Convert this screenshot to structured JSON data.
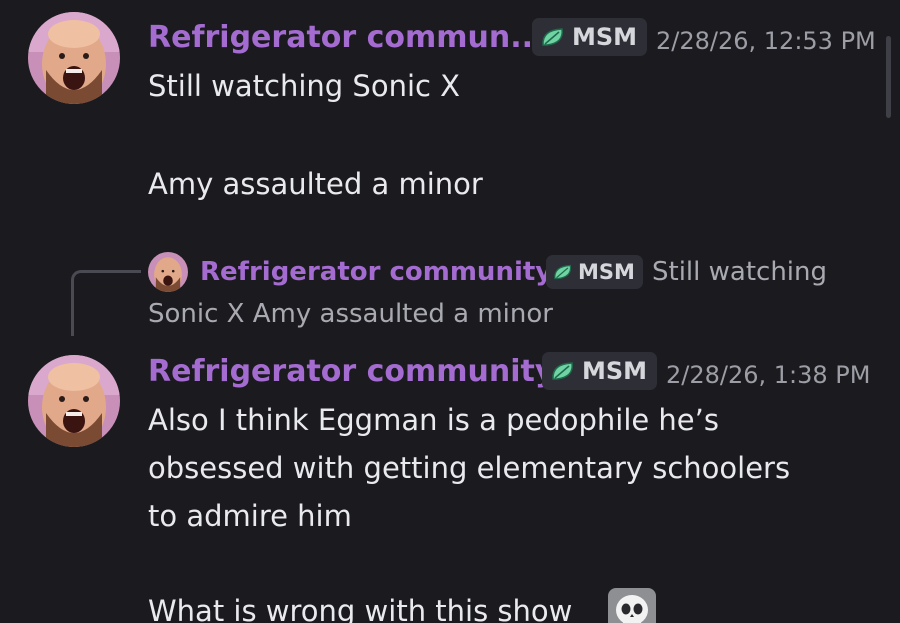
{
  "messages": [
    {
      "username": "Refrigerator commun...",
      "badge": "MSM",
      "timestamp": "2/28/26, 12:53 PM",
      "lines": [
        "Still watching Sonic X",
        "Amy assaulted a minor"
      ]
    },
    {
      "reply": {
        "username": "Refrigerator community",
        "badge": "MSM",
        "text_line1": "Still watching",
        "text_line2": "Sonic X  Amy assaulted a minor"
      },
      "username": "Refrigerator community",
      "badge": "MSM",
      "timestamp": "2/28/26, 1:38 PM",
      "lines": [
        "Also I think Eggman is a pedophile he’s",
        "obsessed with getting elementary schoolers",
        "to admire him",
        "What is wrong with this show"
      ],
      "emoji": "skull-emoji"
    }
  ],
  "colors": {
    "background": "#1b1b1f",
    "username": "#a46bd0",
    "message_text": "#e9eaee",
    "timestamp": "#9c9da5",
    "badge_bg": "#2e2f36",
    "badge_leaf": "#6fd3a3"
  },
  "icons": [
    "leaf-icon",
    "skull-emoji",
    "avatar"
  ]
}
